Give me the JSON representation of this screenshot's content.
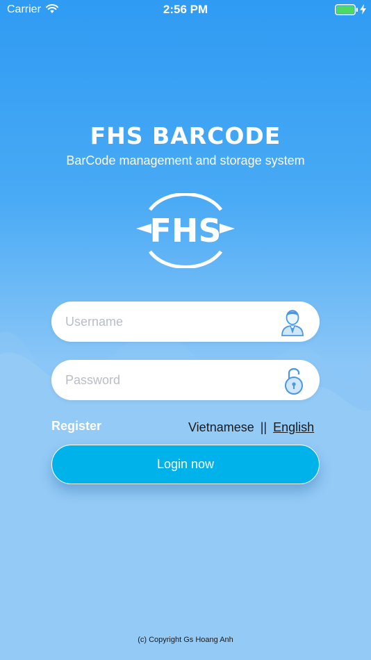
{
  "status_bar": {
    "carrier": "Carrier",
    "time": "2:56 PM"
  },
  "header": {
    "title": "FHS BARCODE",
    "subtitle": "BarCode management and storage system",
    "logo_text": "FHS"
  },
  "form": {
    "username_placeholder": "Username",
    "username_value": "",
    "password_placeholder": "Password",
    "password_value": ""
  },
  "links": {
    "register": "Register",
    "lang_vietnamese": "Vietnamese",
    "lang_separator": "||",
    "lang_english": "English"
  },
  "login_button": "Login now",
  "footer": {
    "copyright": "(c) Copyright Gs Hoang Anh"
  },
  "icons": {
    "wifi": "wifi-icon",
    "battery": "battery-icon",
    "charging": "charging-bolt-icon",
    "user": "user-avatar-icon",
    "lock": "unlocked-padlock-icon"
  },
  "colors": {
    "background_top": "#2f9bf3",
    "background_bottom": "#93caf6",
    "button": "#00b2ea",
    "field": "#ffffff",
    "battery": "#4cd964"
  }
}
